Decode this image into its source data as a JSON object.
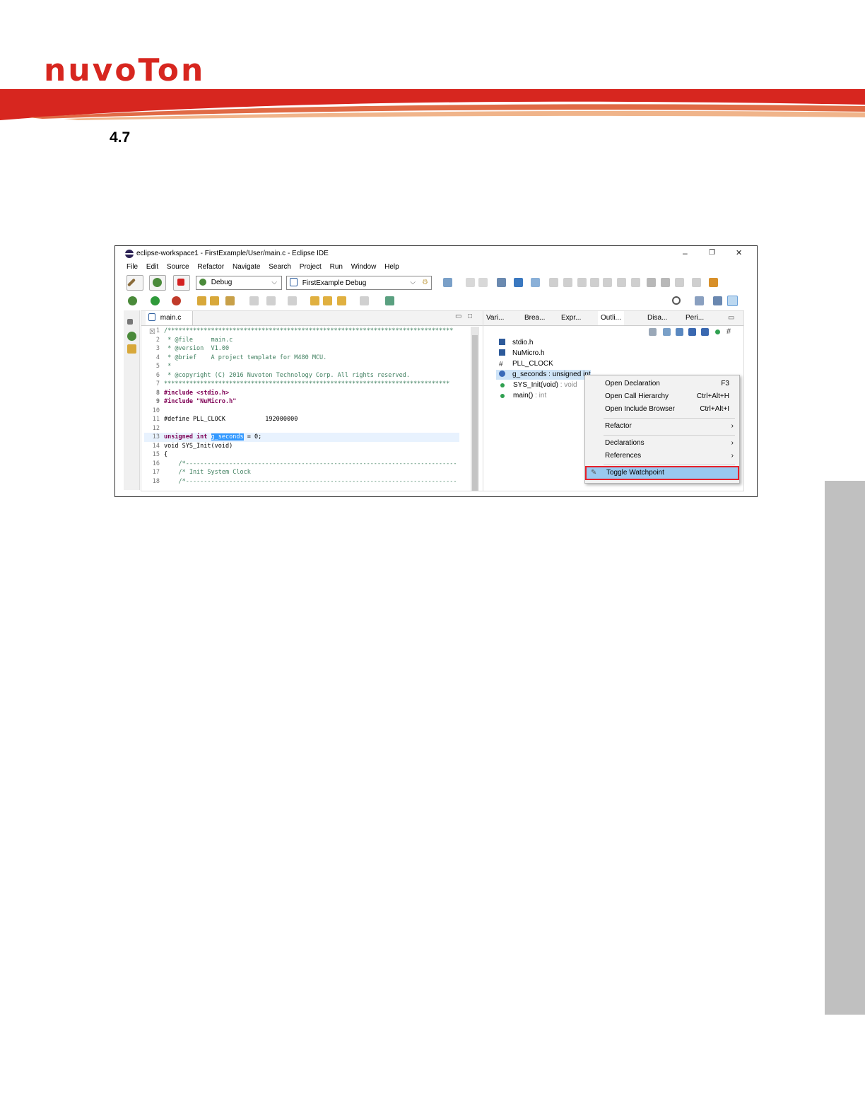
{
  "header": {
    "logo_text": "nuvoTon"
  },
  "section": {
    "number": "4.7"
  },
  "colors": {
    "brand_red": "#d7261f",
    "accent_orange": "#e8a070",
    "menu_highlight": "#99c9ef",
    "highlight_border": "#e8202a"
  },
  "window": {
    "title": "eclipse-workspace1 - FirstExample/User/main.c - Eclipse IDE",
    "controls": [
      "–",
      "❐",
      "✕"
    ]
  },
  "menubar": [
    "File",
    "Edit",
    "Source",
    "Refactor",
    "Navigate",
    "Search",
    "Project",
    "Run",
    "Window",
    "Help"
  ],
  "toolbar": {
    "launch_mode": "Debug",
    "launch_config": "FirstExample Debug"
  },
  "editor": {
    "tab_label": "main.c",
    "lines": [
      {
        "n": "1",
        "t": "/*******************************************************************************"
      },
      {
        "n": "2",
        "t": " * @file     main.c"
      },
      {
        "n": "3",
        "t": " * @version  V1.00"
      },
      {
        "n": "4",
        "t": " * @brief    A project template for M480 MCU."
      },
      {
        "n": "5",
        "t": " *"
      },
      {
        "n": "6",
        "t": " * @copyright (C) 2016 Nuvoton Technology Corp. All rights reserved."
      },
      {
        "n": "7",
        "t": "*******************************************************************************"
      },
      {
        "n": "8",
        "t": "#include <stdio.h>"
      },
      {
        "n": "9",
        "t": "#include \"NuMicro.h\""
      },
      {
        "n": "10",
        "t": ""
      },
      {
        "n": "11",
        "t": "#define PLL_CLOCK           192000000"
      },
      {
        "n": "12",
        "t": ""
      },
      {
        "n": "13",
        "t": "unsigned int g_seconds = 0;"
      },
      {
        "n": "14",
        "t": "void SYS_Init(void)"
      },
      {
        "n": "15",
        "t": "{"
      },
      {
        "n": "16",
        "t": "    /*---------------------------------------------------------------------------"
      },
      {
        "n": "17",
        "t": "    /* Init System Clock"
      },
      {
        "n": "18",
        "t": "    /*---------------------------------------------------------------------------"
      }
    ]
  },
  "views": {
    "tabs": [
      "Vari...",
      "Brea...",
      "Expr...",
      "Outli...",
      "Disa...",
      "Peri..."
    ],
    "outline_items": [
      {
        "name": "stdio.h",
        "type": ""
      },
      {
        "name": "NuMicro.h",
        "type": ""
      },
      {
        "name": "PLL_CLOCK",
        "type": ""
      },
      {
        "name": "g_seconds : unsigned int",
        "type": ""
      },
      {
        "name": "SYS_Init(void)",
        "type": " : void"
      },
      {
        "name": "main()",
        "type": " : int"
      }
    ]
  },
  "context_menu": {
    "items": [
      {
        "label": "Open Declaration",
        "shortcut": "F3"
      },
      {
        "label": "Open Call Hierarchy",
        "shortcut": "Ctrl+Alt+H"
      },
      {
        "label": "Open Include Browser",
        "shortcut": "Ctrl+Alt+I"
      },
      {
        "label": "Refactor",
        "shortcut": "›"
      },
      {
        "label": "Declarations",
        "shortcut": "›"
      },
      {
        "label": "References",
        "shortcut": "›"
      },
      {
        "label": "Toggle Watchpoint",
        "shortcut": ""
      }
    ]
  }
}
